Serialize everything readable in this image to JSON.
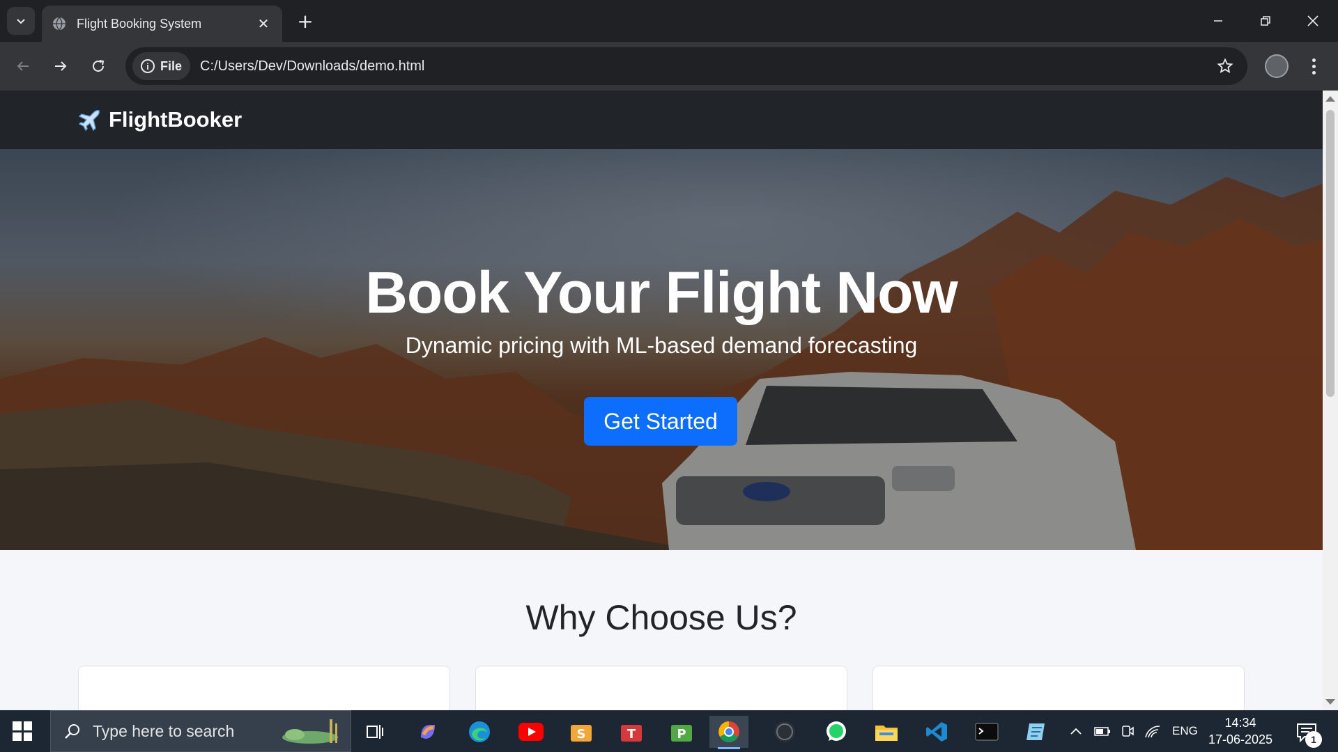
{
  "browser": {
    "tab_title": "Flight Booking System",
    "url_chip": "File",
    "url": "C:/Users/Dev/Downloads/demo.html"
  },
  "site": {
    "brand": "FlightBooker",
    "hero_title": "Book Your Flight Now",
    "hero_subtitle": "Dynamic pricing with ML-based demand forecasting",
    "cta_label": "Get Started",
    "section_title": "Why Choose Us?"
  },
  "taskbar": {
    "search_placeholder": "Type here to search",
    "apps": [
      "task-view",
      "copilot",
      "edge",
      "youtube",
      "ms-store-s",
      "todo-t",
      "project-p",
      "chrome",
      "wordpress",
      "whatsapp",
      "file-explorer",
      "vscode",
      "terminal",
      "notepad"
    ],
    "language": "ENG",
    "time": "14:34",
    "date": "17-06-2025",
    "notification_count": "1"
  },
  "colors": {
    "accent": "#0d6efd",
    "nav_bg": "#212529",
    "page_bg": "#f4f6f9"
  }
}
